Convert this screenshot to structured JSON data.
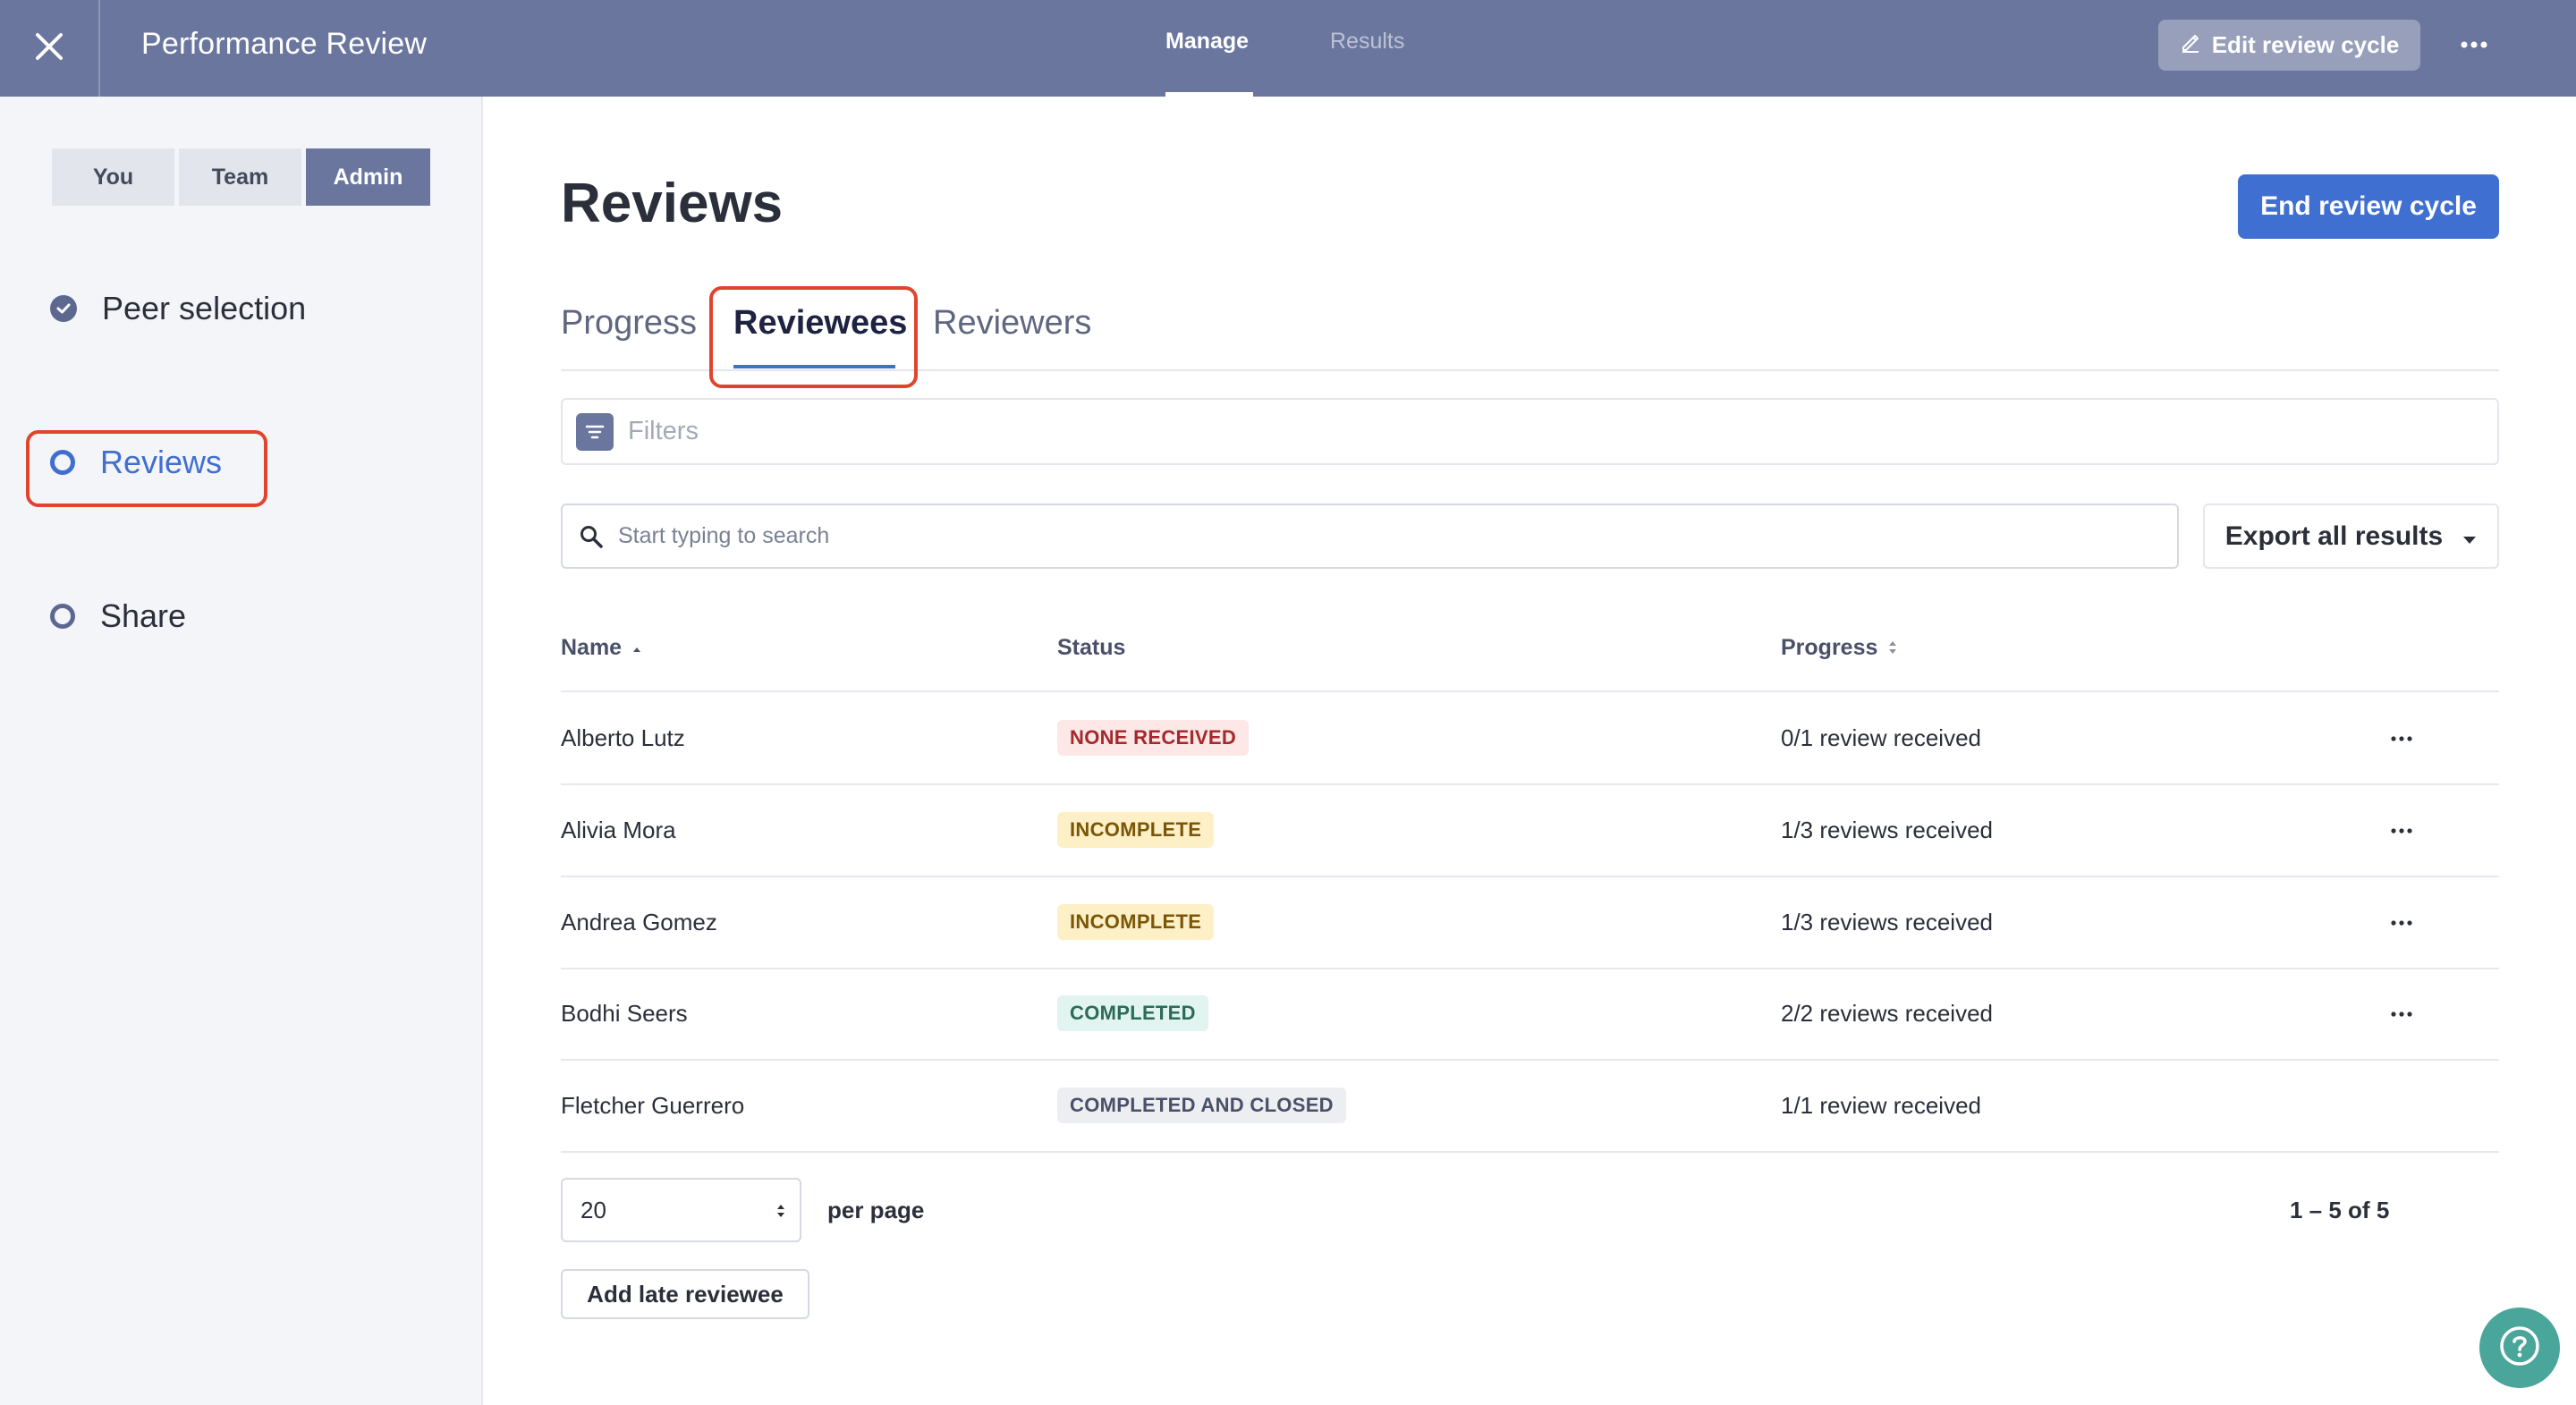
{
  "header": {
    "title": "Performance Review",
    "tabs": [
      {
        "label": "Manage",
        "active": true
      },
      {
        "label": "Results",
        "active": false
      }
    ],
    "edit_button": "Edit review cycle",
    "icons": [
      "close-icon",
      "pencil-icon",
      "more-icon"
    ]
  },
  "sidebar": {
    "segments": [
      {
        "label": "You",
        "active": false
      },
      {
        "label": "Team",
        "active": false
      },
      {
        "label": "Admin",
        "active": true
      }
    ],
    "steps": [
      {
        "label": "Peer selection",
        "state": "done"
      },
      {
        "label": "Reviews",
        "state": "current"
      },
      {
        "label": "Share",
        "state": "pending"
      }
    ]
  },
  "main": {
    "title": "Reviews",
    "end_button": "End review cycle",
    "tabs": [
      {
        "label": "Progress",
        "active": false
      },
      {
        "label": "Reviewees",
        "active": true
      },
      {
        "label": "Reviewers",
        "active": false
      }
    ],
    "filters_label": "Filters",
    "search_placeholder": "Start typing to search",
    "export_label": "Export all results",
    "table": {
      "columns": [
        "Name",
        "Status",
        "Progress"
      ],
      "rows": [
        {
          "name": "Alberto Lutz",
          "status": "NONE RECEIVED",
          "progress": "0/1 review received",
          "has_menu": true
        },
        {
          "name": "Alivia Mora",
          "status": "INCOMPLETE",
          "progress": "1/3 reviews received",
          "has_menu": true
        },
        {
          "name": "Andrea Gomez",
          "status": "INCOMPLETE",
          "progress": "1/3 reviews received",
          "has_menu": true
        },
        {
          "name": "Bodhi Seers",
          "status": "COMPLETED",
          "progress": "2/2 reviews received",
          "has_menu": true
        },
        {
          "name": "Fletcher Guerrero",
          "status": "COMPLETED AND CLOSED",
          "progress": "1/1 review received",
          "has_menu": false
        }
      ]
    },
    "per_page_value": "20",
    "per_page_label": "per page",
    "page_count": "1 – 5 of 5",
    "add_late_button": "Add late reviewee"
  },
  "colors": {
    "header_bg": "#6a769e",
    "accent": "#3f6fd1",
    "highlight": "#e0442f",
    "help_bg": "#4aa59a",
    "badge_none": {
      "bg": "#fde7e7",
      "fg": "#a3292c"
    },
    "badge_incomplete": {
      "bg": "#fdf0c7",
      "fg": "#7a5607"
    },
    "badge_completed": {
      "bg": "#e1f4ef",
      "fg": "#2b6b58"
    },
    "badge_closed": {
      "bg": "#eceef2",
      "fg": "#4a5068"
    }
  }
}
